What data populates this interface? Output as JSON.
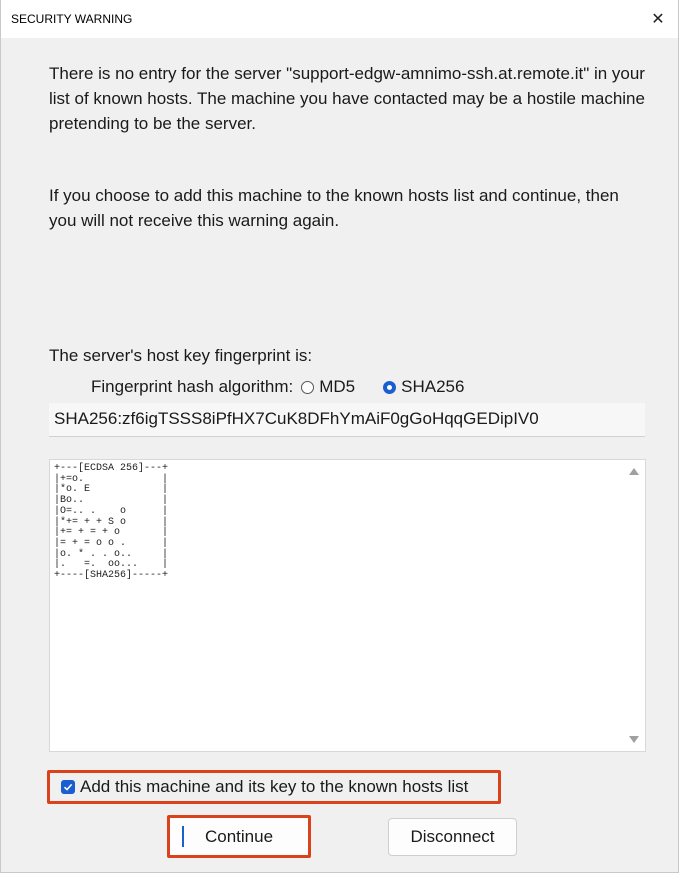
{
  "window": {
    "title": "SECURITY WARNING",
    "close_glyph": "✕"
  },
  "message": {
    "paragraph1": "There is no entry for the server \"support-edgw-amnimo-ssh.at.remote.it\" in your list of known hosts. The machine you have contacted may be a hostile machine pretending to be the server.",
    "paragraph2": "If you choose to add this machine to the known hosts list and continue, then you will not receive this warning again."
  },
  "fingerprint": {
    "label": "The server's host key fingerprint is:",
    "algorithm_label": "Fingerprint hash algorithm:",
    "options": [
      {
        "label": "MD5",
        "selected": false
      },
      {
        "label": "SHA256",
        "selected": true
      }
    ],
    "value": "SHA256:zf6igTSSS8iPfHX7CuK8DFhYmAiF0gGoHqqGEDipIV0",
    "randomart": "+---[ECDSA 256]---+\n|+=o.             |\n|*o. E            |\n|Bo..             |\n|O=.. .    o      |\n|*+= + + S o      |\n|+= + = + o       |\n|= + = o o .      |\n|o. * . . o..     |\n|.   =.  oo...    |\n+----[SHA256]-----+"
  },
  "options": {
    "add_to_known_hosts_label": "Add this machine and its key to the known hosts list",
    "add_to_known_hosts_checked": true
  },
  "buttons": {
    "continue": "Continue",
    "disconnect": "Disconnect"
  },
  "colors": {
    "accent": "#1a5fd0",
    "highlight": "#d9421a"
  }
}
